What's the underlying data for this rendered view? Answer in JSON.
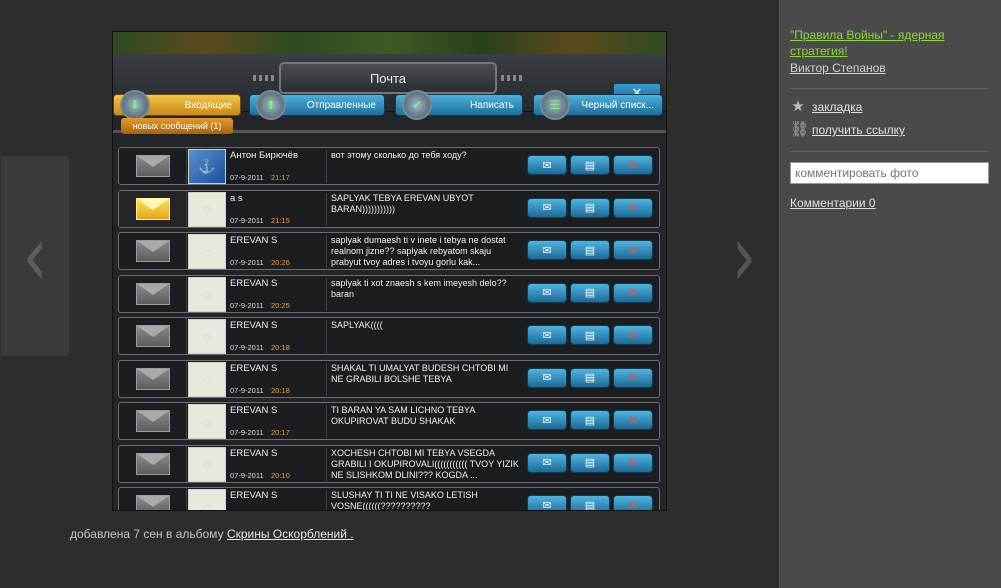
{
  "game": {
    "mail_title": "Почта",
    "close_label": "✕",
    "tabs": [
      {
        "label": "Входящие",
        "icon": "inbox-icon"
      },
      {
        "label": "Отправленные",
        "icon": "sent-icon"
      },
      {
        "label": "Написать",
        "icon": "compose-icon"
      },
      {
        "label": "Черный списк...",
        "icon": "blacklist-icon"
      }
    ],
    "new_messages": "новых сообщений (1)",
    "messages": [
      {
        "sender": "Антон Бирючёв",
        "date": "07-9-2011",
        "time": "21:17",
        "text": "вот этому сколько до тебя ходу?",
        "unread": false,
        "avatar": "photo"
      },
      {
        "sender": "a s",
        "date": "07-9-2011",
        "time": "21:15",
        "text": "SAPLYAK TEBYA EREVAN UBYOT BARAN)))))))))))",
        "unread": true,
        "avatar": "blank"
      },
      {
        "sender": "EREVAN S",
        "date": "07-9-2011",
        "time": "20:26",
        "text": "saplyak dumaesh ti v inete i tebya ne dostat realnom jizne?? saplyak rebyatom skaju prabyut tvoy adres i tvoyu gorlu kak...",
        "unread": false,
        "avatar": "blank"
      },
      {
        "sender": "EREVAN S",
        "date": "07-9-2011",
        "time": "20:25",
        "text": "saplyak ti xot znaesh s kem imeyesh delo?? baran",
        "unread": false,
        "avatar": "blank"
      },
      {
        "sender": "EREVAN S",
        "date": "07-9-2011",
        "time": "20:18",
        "text": "SAPLYAK((((",
        "unread": false,
        "avatar": "blank"
      },
      {
        "sender": "EREVAN S",
        "date": "07-9-2011",
        "time": "20:18",
        "text": "SHAKAL TI UMALYAT BUDESH CHTOBI MI NE GRABILI BOLSHE TEBYA",
        "unread": false,
        "avatar": "blank"
      },
      {
        "sender": "EREVAN S",
        "date": "07-9-2011",
        "time": "20:17",
        "text": "TI BARAN YA SAM LICHNO TEBYA OKUPIROVAT BUDU SHAKAK",
        "unread": false,
        "avatar": "blank"
      },
      {
        "sender": "EREVAN S",
        "date": "07-9-2011",
        "time": "20:10",
        "text": "XOCHESH CHTOBI MI TEBYA VSEGDA GRABILI I OKUPIROVALI((((((((((( TVOY YIZIK NE SLISHKOM DLINI??? KOGDA ...",
        "unread": false,
        "avatar": "blank"
      },
      {
        "sender": "EREVAN S",
        "date": "",
        "time": "",
        "text": "SLUSHAY TI TI NE VISAKO LETISH VOSNE((((((??????????",
        "unread": false,
        "avatar": "blank"
      }
    ],
    "action_icons": [
      "reply-icon",
      "trash-icon",
      "delete-icon"
    ]
  },
  "caption": {
    "prefix": "добавлена 7 сен в альбому",
    "album_link": "Скрины Оскорблений ."
  },
  "nav": {
    "prev": "‹",
    "next": "›"
  },
  "sidebar": {
    "close": "✕",
    "title_link": "\"Правила Войны\" - ядерная стратегия!",
    "author": "Виктор Степанов",
    "bookmark": "закладка",
    "get_link": "получить ссылку",
    "comment_placeholder": "комментировать фото",
    "comments": "Комментарии 0"
  },
  "colors": {
    "title_link": "#8fd63a",
    "sidebar_bg": "#4a4a4a",
    "viewer_bg": "#2d2d2d"
  }
}
